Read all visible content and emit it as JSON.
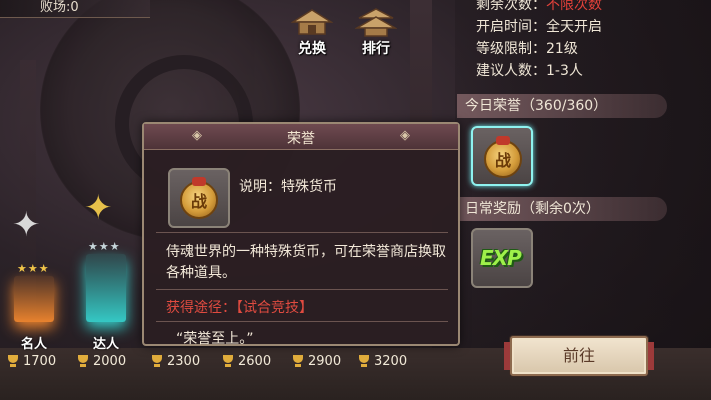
{
  "top_counter": "败场:0",
  "nav": {
    "exchange_label": "兑换",
    "rank_label": "排行"
  },
  "info": {
    "remaining_label": "剩余次数：",
    "remaining_value": "不限次数",
    "open_time": "开启时间：全天开启",
    "level_limit": "等级限制：21级",
    "suggested": "建议人数：1-3人"
  },
  "today_honor": "今日荣誉（360/360）",
  "daily_reward": "日常奖励（剩余0次）",
  "tooltip": {
    "title": "荣誉",
    "icon_char": "战",
    "desc": "说明：特殊货币",
    "body": "侍魂世界的一种特殊货币，可在荣誉商店换取各种道具。",
    "source": "获得途径：【试合竞技】",
    "quote": "“荣誉至上。”"
  },
  "exp_label": "EXP",
  "ranks": {
    "rank1": "名人",
    "rank2": "达人",
    "stars1": "★★★",
    "stars2": "★★★"
  },
  "scores": [
    "1700",
    "2000",
    "2300",
    "2600",
    "2900",
    "3200"
  ],
  "go_button": "前往",
  "colors": {
    "accent_red": "#e2413a",
    "highlight_cyan": "#8ff3f0",
    "rank1_glow": "#e8822e",
    "rank2_glow": "#35c8c4"
  }
}
